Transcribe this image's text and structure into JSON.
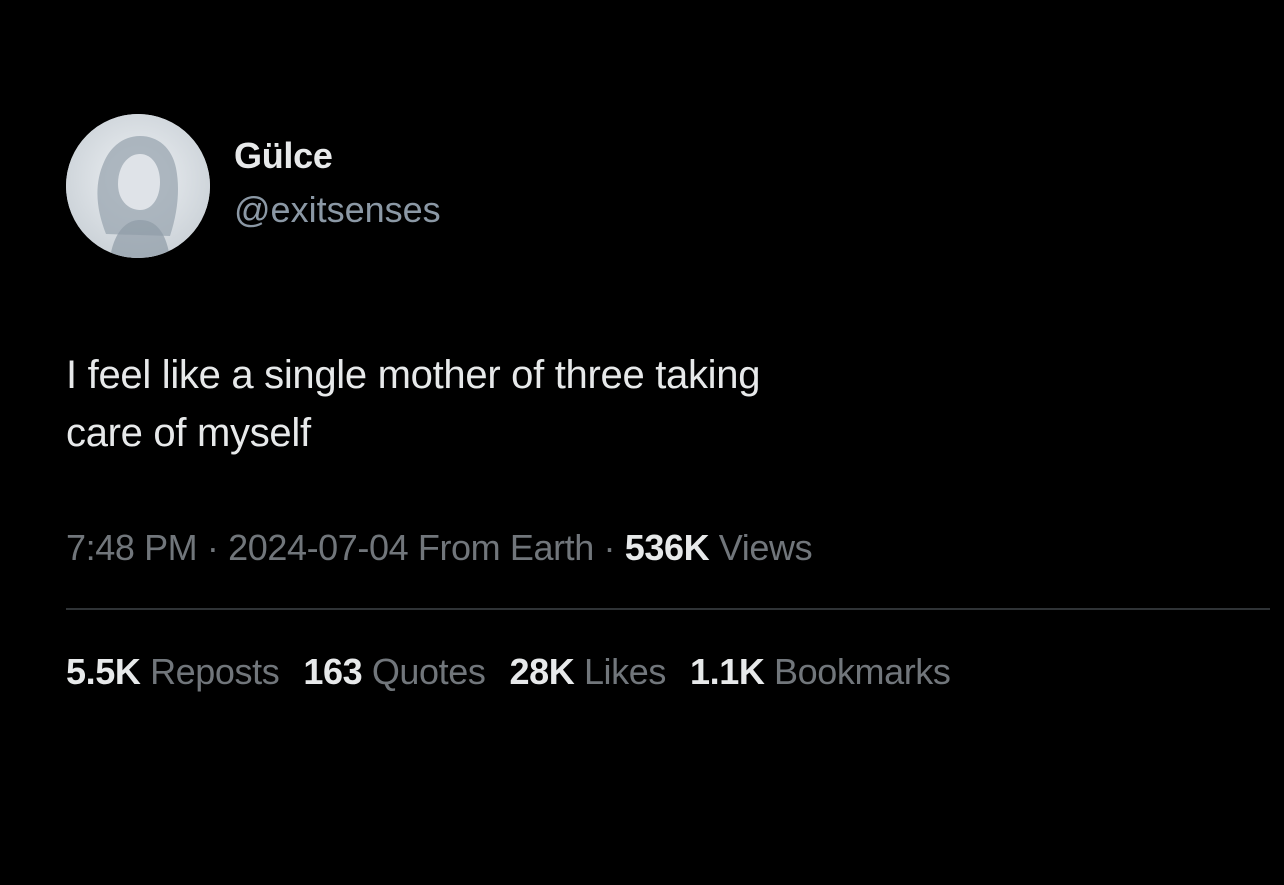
{
  "user": {
    "display_name": "Gülce",
    "handle": "@exitsenses",
    "avatar_icon": "profile-photo"
  },
  "tweet": {
    "text_line1": "I feel like a single mother of three taking",
    "text_line2": "care of myself"
  },
  "meta": {
    "time": "7:48 PM",
    "separator1": "·",
    "date": "2024-07-04",
    "source": "From Earth",
    "separator2": "·",
    "views_count": "536K",
    "views_label": "Views"
  },
  "stats": {
    "reposts_count": "5.5K",
    "reposts_label": "Reposts",
    "quotes_count": "163",
    "quotes_label": "Quotes",
    "likes_count": "28K",
    "likes_label": "Likes",
    "bookmarks_count": "1.1K",
    "bookmarks_label": "Bookmarks"
  },
  "colors": {
    "background": "#000000",
    "primary_text": "#e7e9ea",
    "secondary_text": "#71767b",
    "divider": "#2f3336"
  }
}
